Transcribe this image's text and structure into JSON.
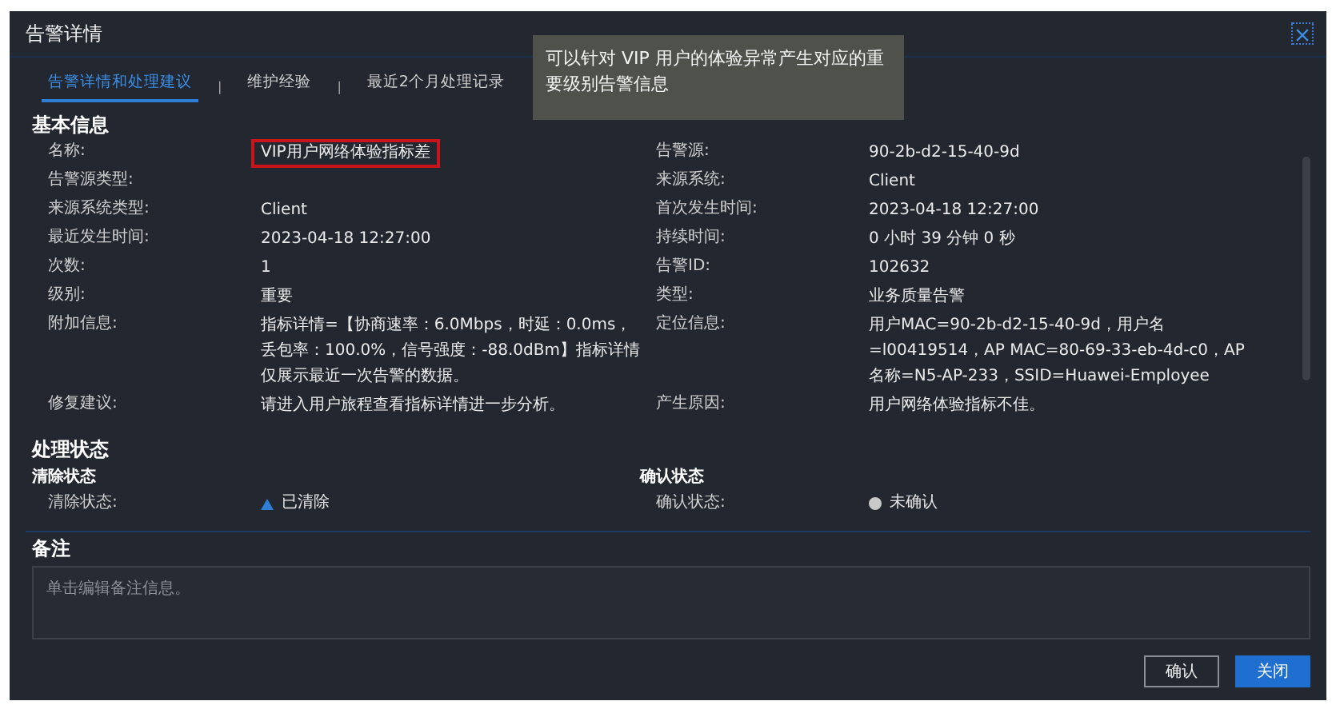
{
  "dialog": {
    "title": "告警详情"
  },
  "tabs": [
    {
      "label": "告警详情和处理建议",
      "selected": true
    },
    {
      "label": "维护经验",
      "selected": false
    },
    {
      "label": "最近2个月处理记录",
      "selected": false
    }
  ],
  "tab_separators": [
    "|",
    "|"
  ],
  "tooltip": {
    "text": "可以针对 VIP 用户的体验异常产生对应的重要级别告警信息"
  },
  "basic_info": {
    "heading": "基本信息",
    "rows": [
      {
        "left": {
          "label": "名称:",
          "value": "VIP用户网络体验指标差",
          "highlighted": true
        },
        "right": {
          "label": "告警源:",
          "value": "90-2b-d2-15-40-9d",
          "highlighted": false
        }
      },
      {
        "left": {
          "label": "告警源类型:",
          "highlighted": false
        },
        "right": {
          "label": "来源系统:",
          "value": "Client",
          "highlighted": false
        }
      },
      {
        "left": {
          "label": "来源系统类型:",
          "value": "Client",
          "highlighted": false
        },
        "right": {
          "label": "首次发生时间:",
          "value": "2023-04-18 12:27:00",
          "highlighted": false
        }
      },
      {
        "left": {
          "label": "最近发生时间:",
          "value": "2023-04-18 12:27:00",
          "highlighted": false
        },
        "right": {
          "label": "持续时间:",
          "value": "0 小时 39 分钟 0 秒",
          "highlighted": false
        }
      },
      {
        "left": {
          "label": "次数:",
          "value": "1",
          "highlighted": false
        },
        "right": {
          "label": "告警ID:",
          "value": "102632",
          "highlighted": false
        }
      },
      {
        "left": {
          "label": "级别:",
          "value": "重要",
          "highlighted": false
        },
        "right": {
          "label": "类型:",
          "value": "业务质量告警",
          "highlighted": false
        }
      },
      {
        "left": {
          "label": "附加信息:",
          "value": "指标详情=【协商速率：6.0Mbps，时延：0.0ms，丢包率：100.0%，信号强度：-88.0dBm】指标详情仅展示最近一次告警的数据。",
          "highlighted": false
        },
        "right": {
          "label": "定位信息:",
          "value": "用户MAC=90-2b-d2-15-40-9d，用户名=l00419514，AP MAC=80-69-33-eb-4d-c0，AP名称=N5-AP-233，SSID=Huawei-Employee",
          "highlighted": false
        }
      },
      {
        "left": {
          "label": "修复建议:",
          "value": "请进入用户旅程查看指标详情进一步分析。",
          "highlighted": false
        },
        "right": {
          "label": "产生原因:",
          "value": "用户网络体验指标不佳。",
          "highlighted": false
        }
      }
    ]
  },
  "processing_status": {
    "heading": "处理状态",
    "groups": [
      {
        "heading": "清除状态",
        "label": "清除状态:",
        "value": "已清除",
        "kind": "triangle"
      },
      {
        "heading": "确认状态",
        "label": "确认状态:",
        "value": "未确认",
        "kind": "circle"
      }
    ]
  },
  "notes": {
    "heading": "备注",
    "placeholder": "单击编辑备注信息。"
  },
  "buttons": [
    {
      "label": "确认",
      "kind": "secondary"
    },
    {
      "label": "关闭",
      "kind": "primary"
    }
  ]
}
